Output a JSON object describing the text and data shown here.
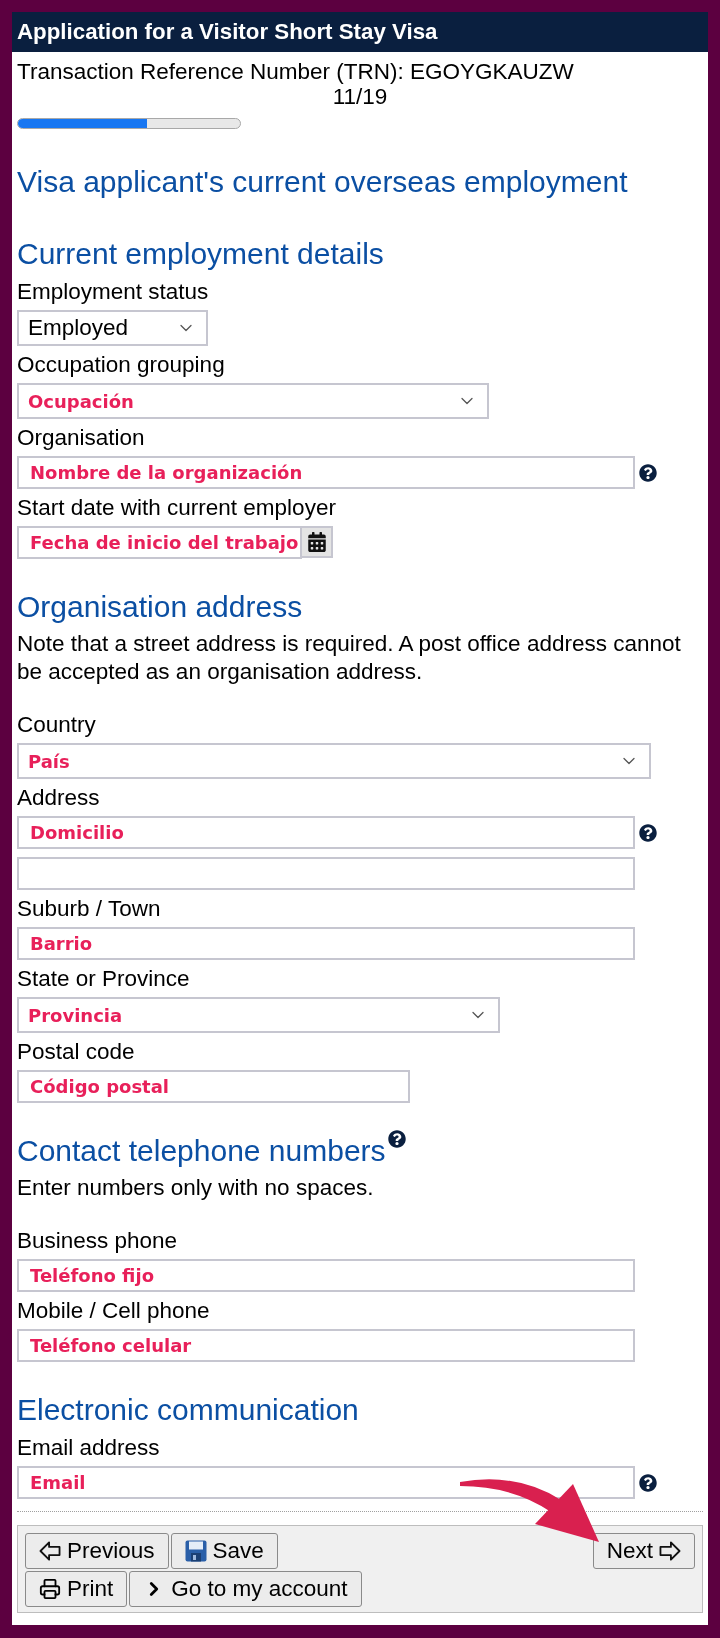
{
  "window": {
    "title": "Application for a Visitor Short Stay Visa"
  },
  "trn": "Transaction Reference Number (TRN): EGOYGKAUZW",
  "progress": {
    "step": "11/19",
    "level": 0.58
  },
  "page_title": "Visa applicant's current overseas employment",
  "sections": [
    {
      "heading": "Current employment details",
      "fields": [
        {
          "kind": "select",
          "label": "Employment status",
          "value": "Employed"
        },
        {
          "kind": "select",
          "label": "Occupation grouping",
          "placeholder": "Ocupación"
        },
        {
          "kind": "text",
          "label": "Organisation",
          "placeholder": "Nombre de la organización",
          "help": true
        },
        {
          "kind": "date",
          "label": "Start date with current employer",
          "placeholder": "Fecha de inicio del trabajo"
        }
      ]
    },
    {
      "heading": "Organisation address",
      "note": "Note that a street address is required. A post office address cannot be accepted as an organisation address.",
      "fields": [
        {
          "kind": "select",
          "label": "Country",
          "placeholder": "País"
        },
        {
          "kind": "text",
          "label": "Address",
          "placeholder": "Domicilio",
          "help": true
        },
        {
          "kind": "text"
        },
        {
          "kind": "text",
          "label": "Suburb / Town",
          "placeholder": "Barrio"
        },
        {
          "kind": "select",
          "label": "State or Province",
          "placeholder": "Provincia"
        },
        {
          "kind": "text",
          "label": "Postal code",
          "placeholder": "Código postal"
        }
      ]
    },
    {
      "heading": "Contact telephone numbers",
      "help": true,
      "note": "Enter numbers only with no spaces.",
      "fields": [
        {
          "kind": "text",
          "label": "Business phone",
          "placeholder": "Teléfono fijo"
        },
        {
          "kind": "text",
          "label": "Mobile / Cell phone",
          "placeholder": "Teléfono celular"
        }
      ]
    },
    {
      "heading": "Electronic communication",
      "fields": [
        {
          "kind": "text",
          "label": "Email address",
          "placeholder": "Email",
          "help": true
        }
      ]
    }
  ],
  "actions": {
    "rows": [
      [
        {
          "kind": "previous",
          "label": "Previous"
        },
        {
          "kind": "save",
          "label": "Save"
        }
      ],
      [
        {
          "kind": "print",
          "label": "Print"
        },
        {
          "kind": "account",
          "label": "Go to my account"
        }
      ]
    ],
    "next": {
      "kind": "next",
      "label": "Next"
    }
  }
}
